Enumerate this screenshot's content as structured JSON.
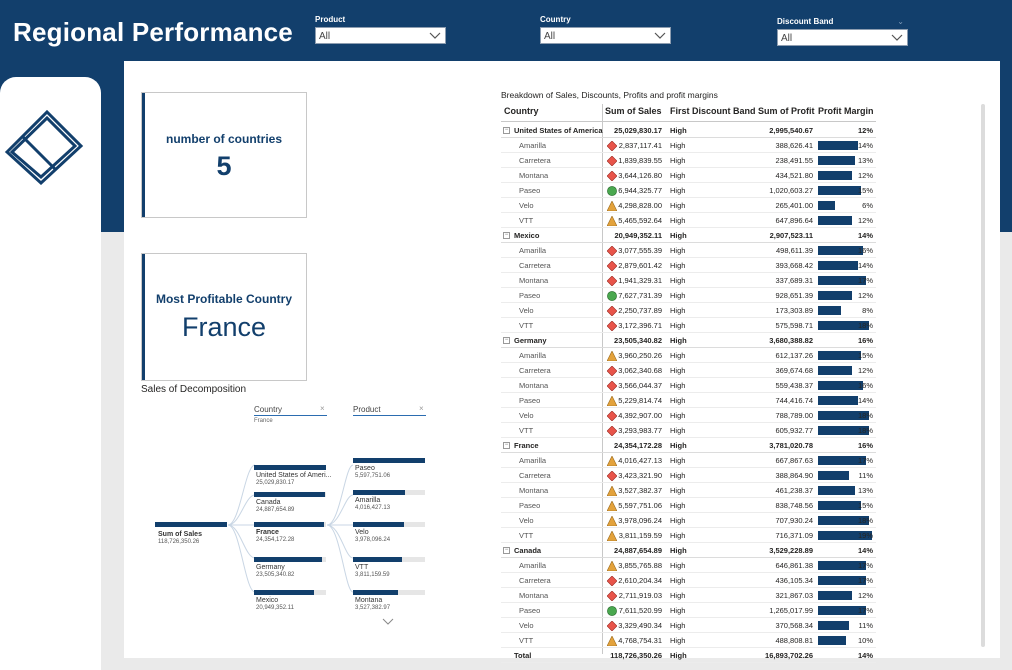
{
  "header": {
    "title": "Regional Performance"
  },
  "slicers": [
    {
      "label": "Product",
      "value": "All"
    },
    {
      "label": "Country",
      "value": "All"
    },
    {
      "label": "Discount Band",
      "value": "All"
    }
  ],
  "cards": {
    "countries": {
      "label": "number of countries",
      "value": "5"
    },
    "profitable": {
      "label": "Most Profitable Country",
      "value": "France"
    }
  },
  "decomposition": {
    "title": "Sales of Decomposition",
    "level1": {
      "header": "Country",
      "filter": "France"
    },
    "level2": {
      "header": "Product"
    },
    "root": {
      "label": "Sum of Sales",
      "value": "118,726,350.26"
    },
    "countries": [
      {
        "label": "United States of Ameri...",
        "value": "25,029,830.17",
        "fill": 1.0
      },
      {
        "label": "Canada",
        "value": "24,887,654.89",
        "fill": 0.99
      },
      {
        "label": "France",
        "value": "24,354,172.28",
        "fill": 0.97
      },
      {
        "label": "Germany",
        "value": "23,505,340.82",
        "fill": 0.94
      },
      {
        "label": "Mexico",
        "value": "20,949,352.11",
        "fill": 0.84
      }
    ],
    "products": [
      {
        "label": "Paseo",
        "value": "5,597,751.06",
        "fill": 1.0
      },
      {
        "label": "Amarilla",
        "value": "4,016,427.13",
        "fill": 0.72
      },
      {
        "label": "Velo",
        "value": "3,978,096.24",
        "fill": 0.71
      },
      {
        "label": "VTT",
        "value": "3,811,159.59",
        "fill": 0.68
      },
      {
        "label": "Montana",
        "value": "3,527,382.97",
        "fill": 0.63
      }
    ]
  },
  "table": {
    "title": "Breakdown of Sales, Discounts, Profits and profit margins",
    "columns": [
      "Country",
      "Sum of Sales",
      "First Discount Band",
      "Sum of Profit",
      "Profit Margin"
    ],
    "rows": [
      {
        "type": "grp",
        "country": "United States of America",
        "sales": "25,029,830.17",
        "band": "High",
        "profit": "2,995,540.67",
        "margin": "12%"
      },
      {
        "type": "item",
        "country": "Amarilla",
        "sales": "2,837,117.41",
        "band": "High",
        "profit": "388,626.41",
        "margin": "14%",
        "kpi": "red",
        "m": 0.14
      },
      {
        "type": "item",
        "country": "Carretera",
        "sales": "1,839,839.55",
        "band": "High",
        "profit": "238,491.55",
        "margin": "13%",
        "kpi": "red",
        "m": 0.13
      },
      {
        "type": "item",
        "country": "Montana",
        "sales": "3,644,126.80",
        "band": "High",
        "profit": "434,521.80",
        "margin": "12%",
        "kpi": "red",
        "m": 0.12
      },
      {
        "type": "item",
        "country": "Paseo",
        "sales": "6,944,325.77",
        "band": "High",
        "profit": "1,020,603.27",
        "margin": "15%",
        "kpi": "green",
        "m": 0.15
      },
      {
        "type": "item",
        "country": "Velo",
        "sales": "4,298,828.00",
        "band": "High",
        "profit": "265,401.00",
        "margin": "6%",
        "kpi": "yellow",
        "m": 0.06
      },
      {
        "type": "item",
        "country": "VTT",
        "sales": "5,465,592.64",
        "band": "High",
        "profit": "647,896.64",
        "margin": "12%",
        "kpi": "yellow",
        "m": 0.12
      },
      {
        "type": "grp",
        "country": "Mexico",
        "sales": "20,949,352.11",
        "band": "High",
        "profit": "2,907,523.11",
        "margin": "14%"
      },
      {
        "type": "item",
        "country": "Amarilla",
        "sales": "3,077,555.39",
        "band": "High",
        "profit": "498,611.39",
        "margin": "16%",
        "kpi": "red",
        "m": 0.16
      },
      {
        "type": "item",
        "country": "Carretera",
        "sales": "2,879,601.42",
        "band": "High",
        "profit": "393,668.42",
        "margin": "14%",
        "kpi": "red",
        "m": 0.14
      },
      {
        "type": "item",
        "country": "Montana",
        "sales": "1,941,329.31",
        "band": "High",
        "profit": "337,689.31",
        "margin": "17%",
        "kpi": "red",
        "m": 0.17
      },
      {
        "type": "item",
        "country": "Paseo",
        "sales": "7,627,731.39",
        "band": "High",
        "profit": "928,651.39",
        "margin": "12%",
        "kpi": "green",
        "m": 0.12
      },
      {
        "type": "item",
        "country": "Velo",
        "sales": "2,250,737.89",
        "band": "High",
        "profit": "173,303.89",
        "margin": "8%",
        "kpi": "red",
        "m": 0.08
      },
      {
        "type": "item",
        "country": "VTT",
        "sales": "3,172,396.71",
        "band": "High",
        "profit": "575,598.71",
        "margin": "18%",
        "kpi": "red",
        "m": 0.18
      },
      {
        "type": "grp",
        "country": "Germany",
        "sales": "23,505,340.82",
        "band": "High",
        "profit": "3,680,388.82",
        "margin": "16%"
      },
      {
        "type": "item",
        "country": "Amarilla",
        "sales": "3,960,250.26",
        "band": "High",
        "profit": "612,137.26",
        "margin": "15%",
        "kpi": "yellow",
        "m": 0.15
      },
      {
        "type": "item",
        "country": "Carretera",
        "sales": "3,062,340.68",
        "band": "High",
        "profit": "369,674.68",
        "margin": "12%",
        "kpi": "red",
        "m": 0.12
      },
      {
        "type": "item",
        "country": "Montana",
        "sales": "3,566,044.37",
        "band": "High",
        "profit": "559,438.37",
        "margin": "16%",
        "kpi": "red",
        "m": 0.16
      },
      {
        "type": "item",
        "country": "Paseo",
        "sales": "5,229,814.74",
        "band": "High",
        "profit": "744,416.74",
        "margin": "14%",
        "kpi": "yellow",
        "m": 0.14
      },
      {
        "type": "item",
        "country": "Velo",
        "sales": "4,392,907.00",
        "band": "High",
        "profit": "788,789.00",
        "margin": "18%",
        "kpi": "red",
        "m": 0.18
      },
      {
        "type": "item",
        "country": "VTT",
        "sales": "3,293,983.77",
        "band": "High",
        "profit": "605,932.77",
        "margin": "18%",
        "kpi": "red",
        "m": 0.18
      },
      {
        "type": "grp",
        "country": "France",
        "sales": "24,354,172.28",
        "band": "High",
        "profit": "3,781,020.78",
        "margin": "16%"
      },
      {
        "type": "item",
        "country": "Amarilla",
        "sales": "4,016,427.13",
        "band": "High",
        "profit": "667,867.63",
        "margin": "17%",
        "kpi": "yellow",
        "m": 0.17
      },
      {
        "type": "item",
        "country": "Carretera",
        "sales": "3,423,321.90",
        "band": "High",
        "profit": "388,864.90",
        "margin": "11%",
        "kpi": "red",
        "m": 0.11
      },
      {
        "type": "item",
        "country": "Montana",
        "sales": "3,527,382.37",
        "band": "High",
        "profit": "461,238.37",
        "margin": "13%",
        "kpi": "yellow",
        "m": 0.13
      },
      {
        "type": "item",
        "country": "Paseo",
        "sales": "5,597,751.06",
        "band": "High",
        "profit": "838,748.56",
        "margin": "15%",
        "kpi": "yellow",
        "m": 0.15
      },
      {
        "type": "item",
        "country": "Velo",
        "sales": "3,978,096.24",
        "band": "High",
        "profit": "707,930.24",
        "margin": "18%",
        "kpi": "yellow",
        "m": 0.18
      },
      {
        "type": "item",
        "country": "VTT",
        "sales": "3,811,159.59",
        "band": "High",
        "profit": "716,371.09",
        "margin": "19%",
        "kpi": "yellow",
        "m": 0.19
      },
      {
        "type": "grp",
        "country": "Canada",
        "sales": "24,887,654.89",
        "band": "High",
        "profit": "3,529,228.89",
        "margin": "14%"
      },
      {
        "type": "item",
        "country": "Amarilla",
        "sales": "3,855,765.88",
        "band": "High",
        "profit": "646,861.38",
        "margin": "17%",
        "kpi": "yellow",
        "m": 0.17
      },
      {
        "type": "item",
        "country": "Carretera",
        "sales": "2,610,204.34",
        "band": "High",
        "profit": "436,105.34",
        "margin": "17%",
        "kpi": "red",
        "m": 0.17
      },
      {
        "type": "item",
        "country": "Montana",
        "sales": "2,711,919.03",
        "band": "High",
        "profit": "321,867.03",
        "margin": "12%",
        "kpi": "red",
        "m": 0.12
      },
      {
        "type": "item",
        "country": "Paseo",
        "sales": "7,611,520.99",
        "band": "High",
        "profit": "1,265,017.99",
        "margin": "17%",
        "kpi": "green",
        "m": 0.17
      },
      {
        "type": "item",
        "country": "Velo",
        "sales": "3,329,490.34",
        "band": "High",
        "profit": "370,568.34",
        "margin": "11%",
        "kpi": "red",
        "m": 0.11
      },
      {
        "type": "item",
        "country": "VTT",
        "sales": "4,768,754.31",
        "band": "High",
        "profit": "488,808.81",
        "margin": "10%",
        "kpi": "yellow",
        "m": 0.1
      },
      {
        "type": "total",
        "country": "Total",
        "sales": "118,726,350.26",
        "band": "High",
        "profit": "16,893,702.26",
        "margin": "14%"
      }
    ]
  },
  "colors": {
    "brand": "#123f6c",
    "kpi_red": "#e8544a",
    "kpi_yellow": "#e3a23c",
    "kpi_green": "#4aa84f"
  },
  "icons": {
    "logo": "stacked-rectangles-icon",
    "dropdown": "chevron-down-icon"
  }
}
